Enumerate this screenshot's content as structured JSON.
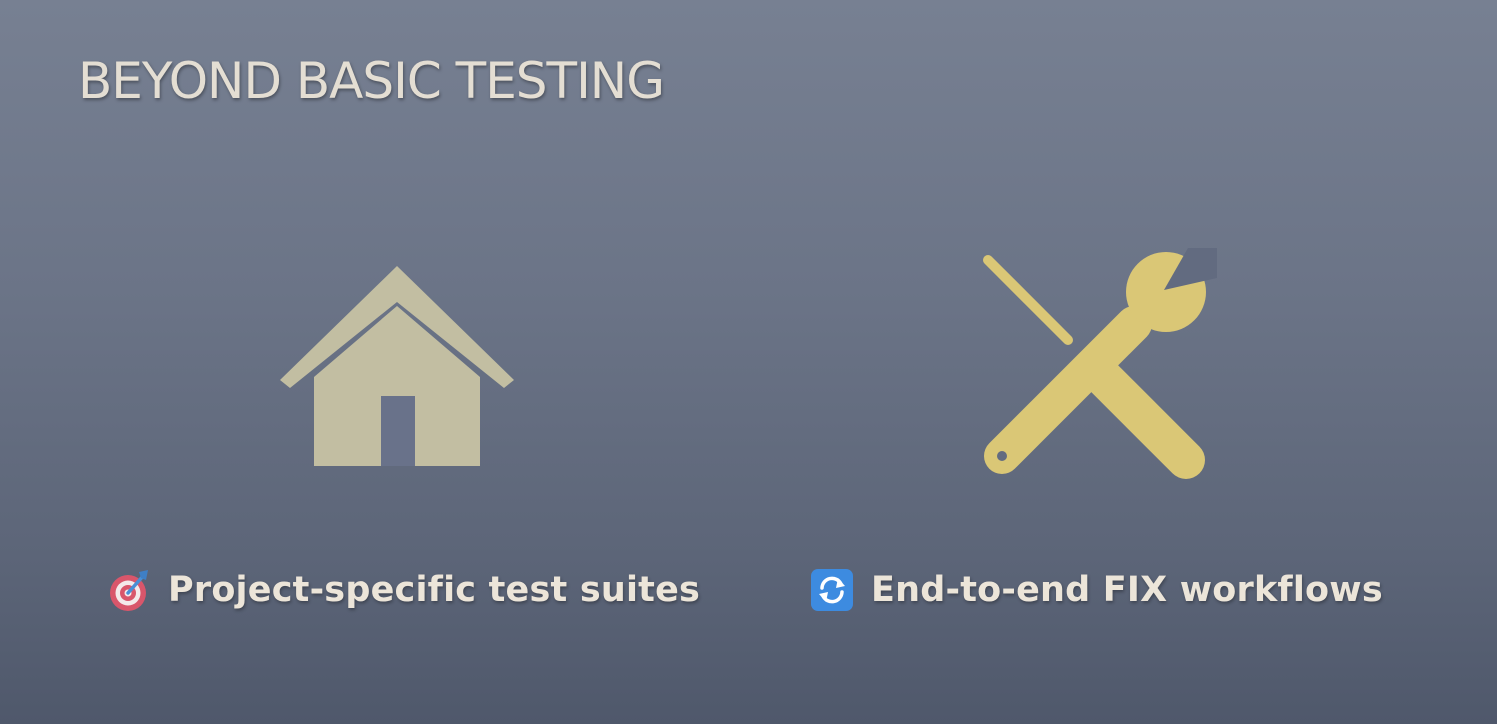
{
  "slide": {
    "title": "BEYOND BASIC TESTING"
  },
  "features": [
    {
      "icon": "house-icon",
      "label": "Project-specific test suites",
      "emoji": "target-icon",
      "icon_color": "#c2bea2"
    },
    {
      "icon": "tools-icon",
      "label": "End-to-end FIX workflows",
      "emoji": "refresh-icon",
      "icon_color": "#dac776"
    }
  ],
  "colors": {
    "background_top": "#778092",
    "background_bottom": "#4f586b",
    "title_text": "#e4ded3",
    "caption_text": "#ece5d9"
  }
}
